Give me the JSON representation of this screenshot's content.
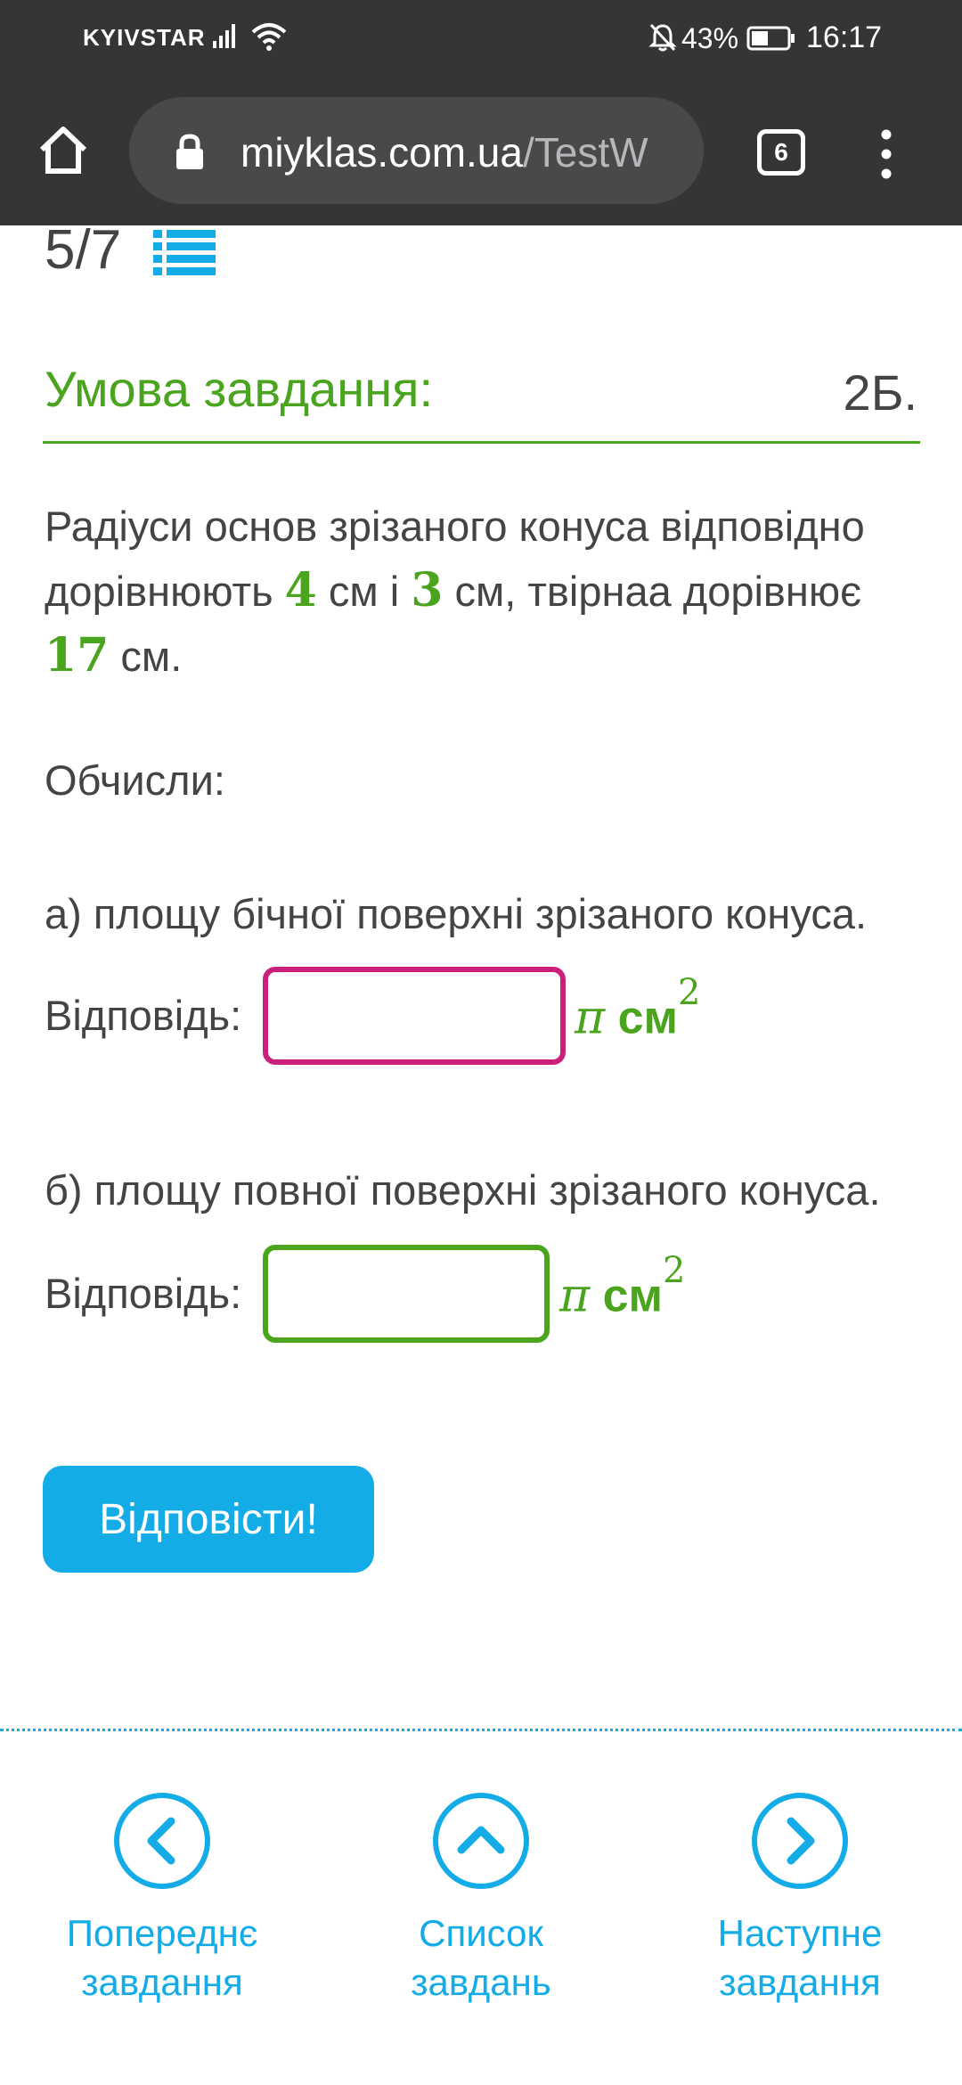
{
  "status_bar": {
    "carrier": "KYIVSTAR",
    "battery": "43%",
    "time": "16:17"
  },
  "browser": {
    "url_host": "miyklas.com.ua",
    "url_path": "/TestW",
    "tab_count": "6"
  },
  "task": {
    "progress": "5/7",
    "title": "Умова завдання:",
    "points": "2Б.",
    "statement_pre": "Радіуси основ зрізаного конуса відповідно дорівнюють ",
    "r1": "4",
    "mid1": " см і ",
    "r2": "3",
    "mid2": " см, твірнаа дорівнює ",
    "l": "17",
    "post": " см.",
    "compute": "Обчисли:",
    "part_a": "а) площу бічної поверхні зрізаного конуса.",
    "part_b": "б) площу повної поверхні зрізаного конуса.",
    "answer_label": "Відповідь:",
    "unit_pi": "π",
    "unit_cm": " см",
    "unit_exp": "2",
    "answer_a": "",
    "answer_b": "",
    "submit": "Відповісти!"
  },
  "nav": {
    "prev_line1": "Попереднє",
    "prev_line2": "завдання",
    "list_line1": "Список",
    "list_line2": "завдань",
    "next_line1": "Наступне",
    "next_line2": "завдання"
  },
  "colors": {
    "accent_green": "#4aa41e",
    "accent_blue": "#13ace7",
    "input_a_border": "#cc1f7a",
    "chrome_bg": "#333537"
  }
}
